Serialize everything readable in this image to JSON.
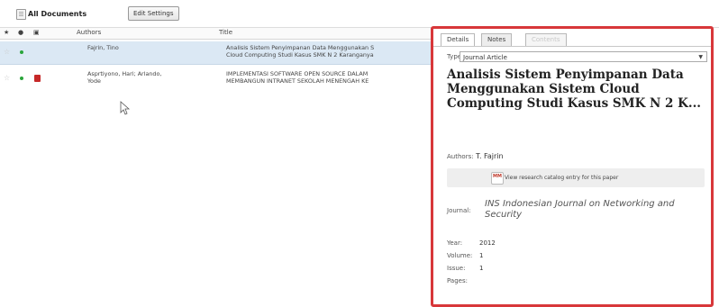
{
  "toolbar": {
    "title": "All Documents",
    "edit_settings_label": "Edit Settings",
    "docs_icon": "documents-icon"
  },
  "grid": {
    "columns": [
      "★",
      "●",
      "▣",
      "Authors",
      "Title"
    ],
    "rows": [
      {
        "authors": "Fajrin, Tino",
        "title_line1": "Analisis Sistem Penyimpanan Data Menggunakan S",
        "title_line2": "Cloud Computing Studi Kasus SMK N 2 Karanganya",
        "read_status_color": "#2aa53b",
        "has_pdf": false,
        "selected": true
      },
      {
        "authors_line1": "Asprtiyono, Hari; Arlando,",
        "authors_line2": "Yode",
        "title_line1": "IMPLEMENTASI SOFTWARE OPEN SOURCE DALAM",
        "title_line2": "MEMBANGUN INTRANET SEKOLAH MENENGAH KE",
        "read_status_color": "#2aa53b",
        "has_pdf": true,
        "selected": false
      }
    ]
  },
  "details": {
    "tabs": [
      {
        "label": "Details",
        "state": "active"
      },
      {
        "label": "Notes",
        "state": "normal"
      },
      {
        "label": "Contents",
        "state": "disabled"
      }
    ],
    "type_label": "Type:",
    "type_value": "Journal Article",
    "paper_title": "Analisis Sistem Penyimpanan Data Menggunakan Sistem Cloud Computing Studi Kasus SMK N 2 K...",
    "authors_label": "Authors:",
    "authors_value": "T. Fajrin",
    "catalog_text": "View research catalog entry for this paper",
    "journal_label": "Journal:",
    "journal_value": "INS Indonesian Journal on Networking and Security",
    "year_label": "Year:",
    "year_value": "2012",
    "volume_label": "Volume:",
    "volume_value": "1",
    "issue_label": "Issue:",
    "issue_value": "1",
    "pages_label": "Pages:",
    "pages_value": ""
  },
  "colors": {
    "highlight_border": "#d8373a",
    "selected_row": "#dbe8f4"
  }
}
